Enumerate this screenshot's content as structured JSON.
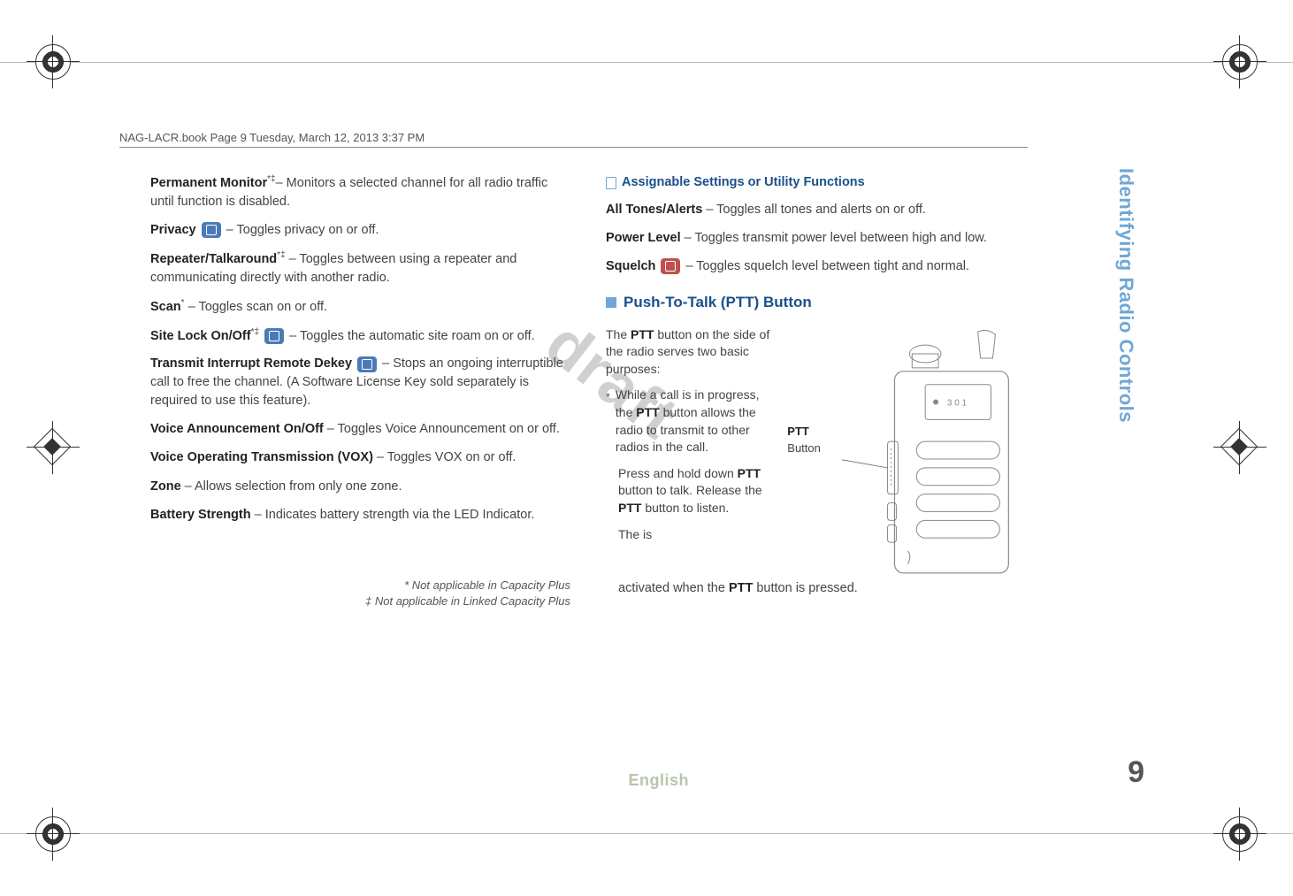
{
  "header_path": "NAG-LACR.book  Page 9  Tuesday, March 12, 2013  3:37 PM",
  "watermark": "draft",
  "left": {
    "perm_monitor_label": "Permanent Monitor",
    "perm_monitor_sup": "*‡",
    "perm_monitor_text": "– Monitors a selected channel for all radio traffic until function is disabled.",
    "privacy_label": "Privacy",
    "privacy_text": " – Toggles privacy on or off.",
    "repeater_label": "Repeater/Talkaround",
    "repeater_sup": "*‡",
    "repeater_text": " – Toggles between using a repeater and communicating directly with another radio.",
    "scan_label": "Scan",
    "scan_sup": "*",
    "scan_text": " – Toggles scan on or off.",
    "sitelock_label": "Site Lock On/Off",
    "sitelock_sup": "*‡",
    "sitelock_text": " – Toggles the automatic site roam on or off.",
    "tir_label": "Transmit Interrupt Remote Dekey",
    "tir_text": " – Stops an ongoing interruptible call to free the channel. (A Software License Key sold separately is required to use this feature).",
    "voice_ann_label": "Voice Announcement On/Off",
    "voice_ann_text": " – Toggles Voice Announcement on or off.",
    "vox_label": "Voice Operating Transmission (VOX)",
    "vox_text": " – Toggles VOX on or off.",
    "zone_label": "Zone",
    "zone_text": " – Allows selection from only one zone.",
    "battery_label": "Battery Strength",
    "battery_text": " – Indicates battery strength via the LED Indicator.",
    "footnote1": "* Not applicable in Capacity Plus",
    "footnote2": "‡ Not applicable in Linked Capacity Plus"
  },
  "right": {
    "assignable_head": "Assignable Settings or Utility Functions",
    "tones_label": "All Tones/Alerts",
    "tones_text": " – Toggles all tones and alerts on or off.",
    "power_label": "Power Level",
    "power_text": " – Toggles transmit power level between high and low.",
    "squelch_label": "Squelch",
    "squelch_text": " – Toggles squelch level between tight and normal.",
    "ptt_head": "Push-To-Talk (PTT) Button",
    "ptt_intro1": "The ",
    "ptt_intro_bold": "PTT",
    "ptt_intro2": " button on the side of the radio serves two basic purposes:",
    "bullet1a": "While a call is in progress, the ",
    "bullet1b": "PTT",
    "bullet1c": " button allows the radio to transmit to other radios in the call.",
    "press1": "Press and hold down ",
    "press_bold1": "PTT",
    "press2": " button to talk. Release the ",
    "press_bold2": "PTT",
    "press3": " button to listen.",
    "the_is": "The  is",
    "activated1": "activated when the ",
    "activated_bold": "PTT",
    "activated2": " button is pressed.",
    "ptt_callout_label": "PTT",
    "ptt_callout_sub": "Button"
  },
  "side": {
    "title": "Identifying Radio Controls",
    "page": "9"
  },
  "footer_lang": "English"
}
